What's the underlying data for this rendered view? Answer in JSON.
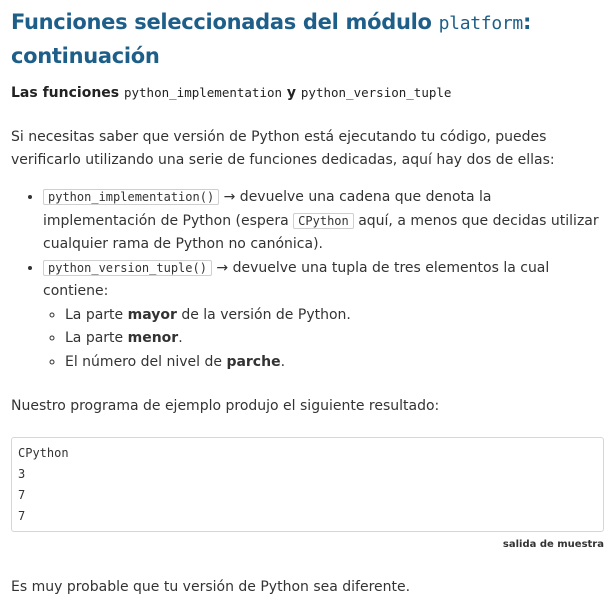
{
  "heading": {
    "title_prefix": "Funciones seleccionadas del módulo ",
    "title_code": "platform",
    "title_suffix": ":",
    "title_line2": "continuación"
  },
  "subheading": {
    "prefix": "Las funciones ",
    "code1": "python_implementation",
    "joiner": " y ",
    "code2": "python_version_tuple"
  },
  "intro": "Si necesitas saber que versión de Python está ejecutando tu código, puedes verificarlo utilizando una serie de funciones dedicadas, aquí hay dos de ellas:",
  "list": {
    "item1": {
      "code": "python_implementation()",
      "text_a": " → devuelve una cadena que denota la implementación de Python (espera ",
      "code2": "CPython",
      "text_b": " aquí, a menos que decidas utilizar cualquier rama de Python no canónica)."
    },
    "item2": {
      "code": "python_version_tuple()",
      "text": " → devuelve una tupla de tres elementos la cual contiene:",
      "subitems": [
        {
          "pre": "La parte ",
          "bold": "mayor",
          "post": " de la versión de Python."
        },
        {
          "pre": "La parte ",
          "bold": "menor",
          "post": "."
        },
        {
          "pre": "El número del nivel de ",
          "bold": "parche",
          "post": "."
        }
      ]
    }
  },
  "result_intro": "Nuestro programa de ejemplo produjo el siguiente resultado:",
  "output": {
    "lines": [
      "CPython",
      "3",
      "7",
      "7"
    ],
    "caption": "salida de muestra"
  },
  "closing": "Es muy probable que tu versión de Python sea diferente."
}
